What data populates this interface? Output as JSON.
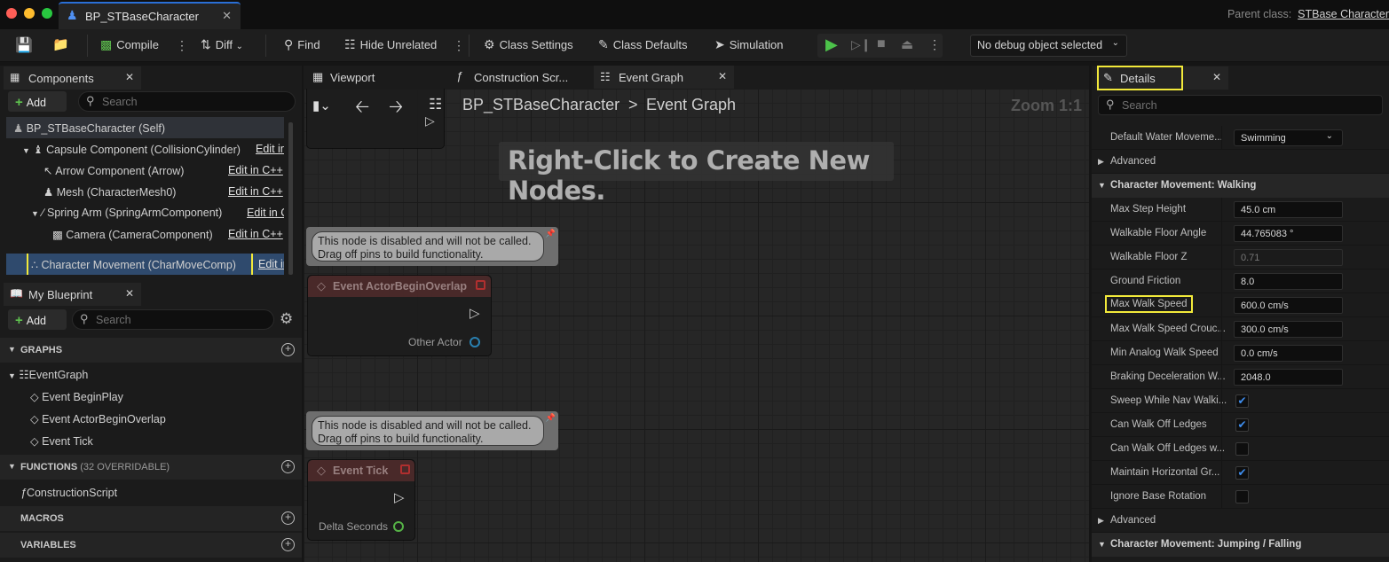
{
  "window": {
    "tab_title": "BP_STBaseCharacter",
    "parent_class_label": "Parent class:",
    "parent_class_value": "STBase Character"
  },
  "toolbar": {
    "compile": "Compile",
    "diff": "Diff",
    "find": "Find",
    "hide_unrelated": "Hide Unrelated",
    "class_settings": "Class Settings",
    "class_defaults": "Class Defaults",
    "simulation": "Simulation",
    "debug_object": "No debug object selected"
  },
  "components": {
    "tab": "Components",
    "add": "Add",
    "search_placeholder": "Search",
    "items": [
      {
        "label": "BP_STBaseCharacter (Self)",
        "edit": ""
      },
      {
        "label": "Capsule Component (CollisionCylinder)",
        "edit": "Edit in C++"
      },
      {
        "label": "Arrow Component (Arrow)",
        "edit": "Edit in C++"
      },
      {
        "label": "Mesh (CharacterMesh0)",
        "edit": "Edit in C++"
      },
      {
        "label": "Spring Arm (SpringArmComponent)",
        "edit": "Edit in C++"
      },
      {
        "label": "Camera (CameraComponent)",
        "edit": "Edit in C++"
      },
      {
        "label": "Character Movement (CharMoveComp)",
        "edit": "Edit in C++"
      }
    ]
  },
  "my_blueprint": {
    "tab": "My Blueprint",
    "add": "Add",
    "search_placeholder": "Search",
    "graphs_header": "GRAPHS",
    "event_graph": "EventGraph",
    "events": [
      "Event BeginPlay",
      "Event ActorBeginOverlap",
      "Event Tick"
    ],
    "functions_header": "FUNCTIONS",
    "functions_sub": "(32 OVERRIDABLE)",
    "construction_script": "ConstructionScript",
    "macros_header": "MACROS",
    "variables_header": "VARIABLES"
  },
  "editor_tabs": {
    "viewport": "Viewport",
    "construction": "Construction Scr...",
    "event_graph": "Event Graph"
  },
  "graph": {
    "breadcrumb_bp": "BP_STBaseCharacter",
    "breadcrumb_sep": ">",
    "breadcrumb_graph": "Event Graph",
    "zoom": "Zoom 1:1",
    "hint": "Right-Click to Create New Nodes.",
    "disabled_line1": "This node is disabled and will not be called.",
    "disabled_line2": "Drag off pins to build functionality.",
    "node_overlap_title": "Event ActorBeginOverlap",
    "node_overlap_pin": "Other Actor",
    "node_tick_title": "Event Tick",
    "node_tick_pin": "Delta Seconds"
  },
  "details": {
    "tab": "Details",
    "search_placeholder": "Search",
    "rows_top": [
      {
        "label": "Default Water Moveme...",
        "value": "Swimming",
        "type": "dropdown"
      }
    ],
    "advanced": "Advanced",
    "cat_walking": "Character Movement: Walking",
    "walking_rows": [
      {
        "label": "Max Step Height",
        "value": "45.0 cm",
        "type": "text"
      },
      {
        "label": "Walkable Floor Angle",
        "value": "44.765083 °",
        "type": "text"
      },
      {
        "label": "Walkable Floor Z",
        "value": "0.71",
        "type": "text"
      },
      {
        "label": "Ground Friction",
        "value": "8.0",
        "type": "text"
      },
      {
        "label": "Max Walk Speed",
        "value": "600.0 cm/s",
        "type": "text"
      },
      {
        "label": "Max Walk Speed Crouc...",
        "value": "300.0 cm/s",
        "type": "text"
      },
      {
        "label": "Min Analog Walk Speed",
        "value": "0.0 cm/s",
        "type": "text"
      },
      {
        "label": "Braking Deceleration W...",
        "value": "2048.0",
        "type": "text"
      },
      {
        "label": "Sweep While Nav Walki...",
        "value": true,
        "type": "check"
      },
      {
        "label": "Can Walk Off Ledges",
        "value": true,
        "type": "check"
      },
      {
        "label": "Can Walk Off Ledges w...",
        "value": false,
        "type": "check"
      },
      {
        "label": "Maintain Horizontal Gr...",
        "value": true,
        "type": "check"
      },
      {
        "label": "Ignore Base Rotation",
        "value": false,
        "type": "check"
      }
    ],
    "cat_jumping": "Character Movement: Jumping / Falling"
  },
  "colors": {
    "highlight": "#f2e93a",
    "accent_blue": "#2a6fd6",
    "play_green": "#4cc24a"
  }
}
